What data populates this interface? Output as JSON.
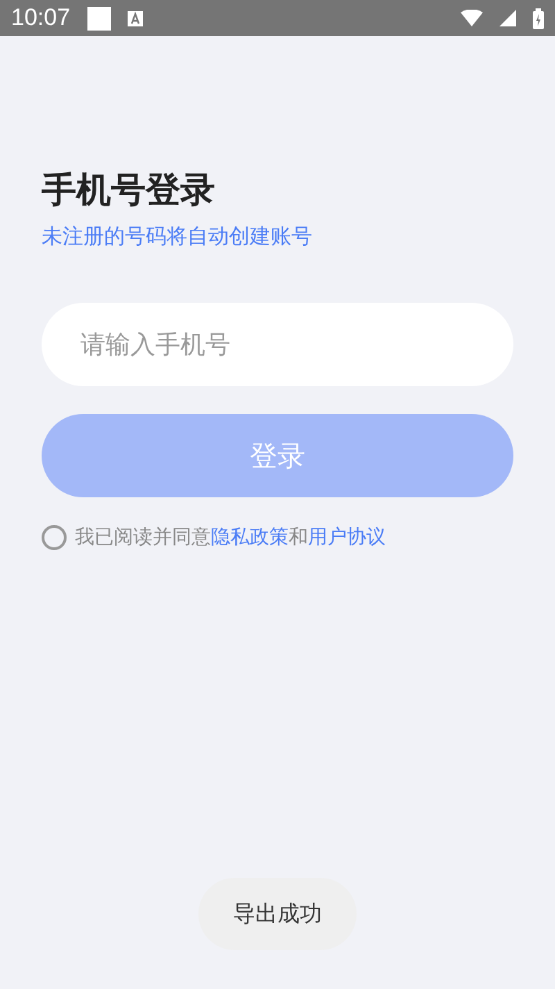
{
  "status_bar": {
    "time": "10:07"
  },
  "title": "手机号登录",
  "subtitle": "未注册的号码将自动创建账号",
  "phone_field": {
    "placeholder": "请输入手机号"
  },
  "login_button": {
    "label": "登录",
    "disabled": true
  },
  "agreement": {
    "checked": false,
    "text": "我已阅读并同意",
    "privacy_link": "隐私政策",
    "joiner": "和",
    "terms_link": "用户协议"
  },
  "toast": "导出成功"
}
